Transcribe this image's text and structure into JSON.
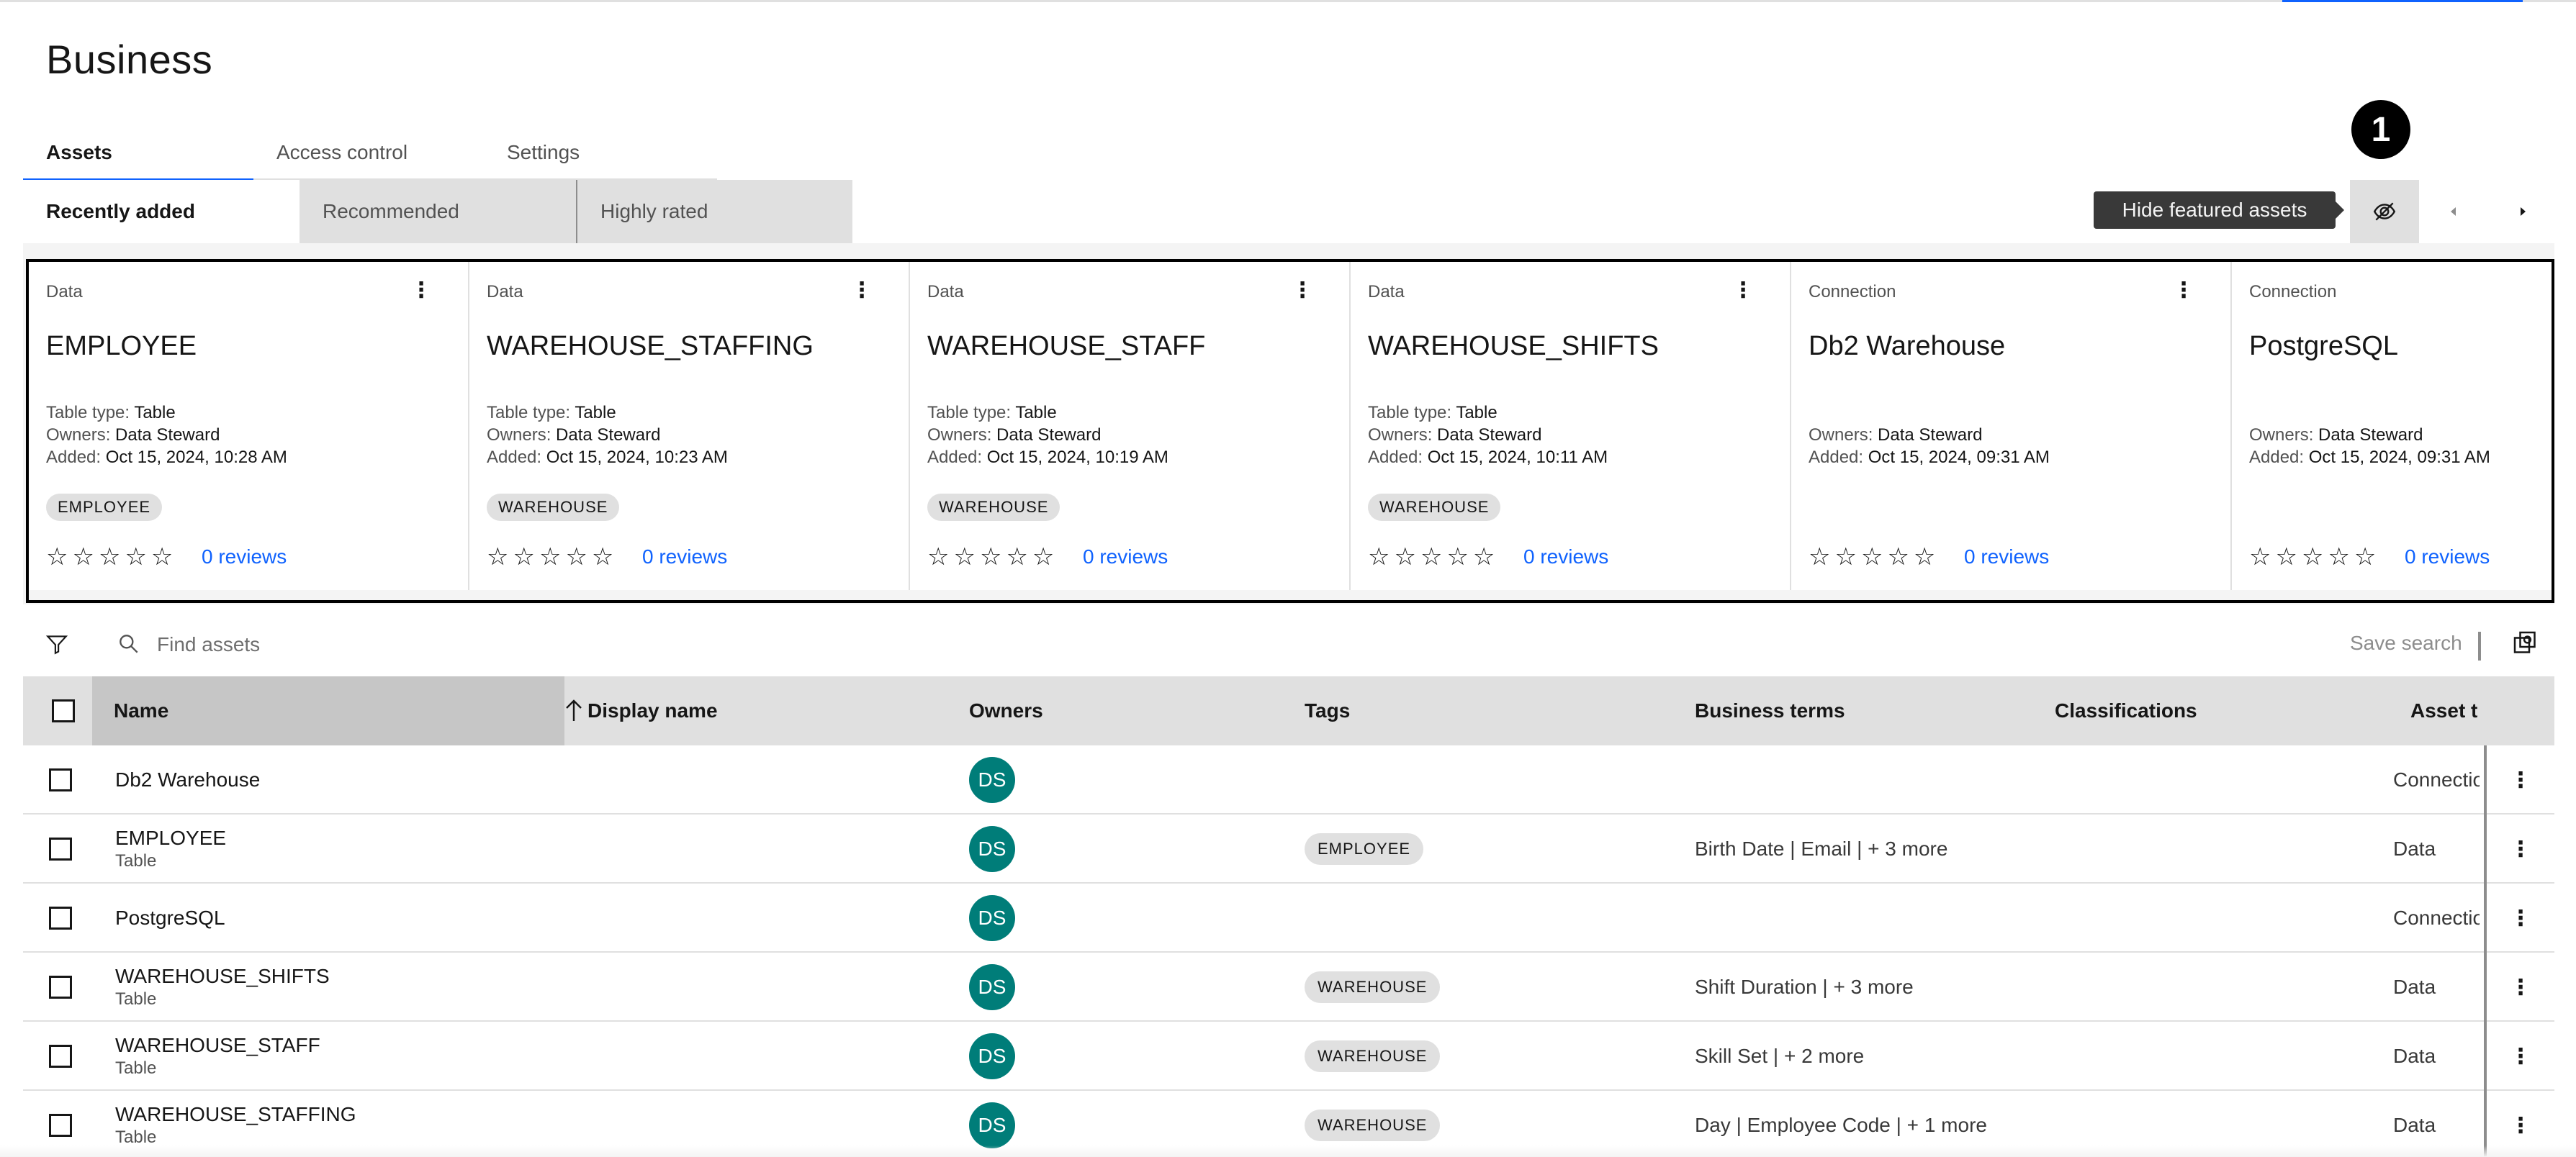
{
  "page": {
    "title": "Business"
  },
  "tabs": [
    "Assets",
    "Access control",
    "Settings"
  ],
  "content_tabs": [
    "Recently added",
    "Recommended",
    "Highly rated"
  ],
  "controls": {
    "tooltip": "Hide featured assets",
    "step_badge": "1"
  },
  "cards": [
    {
      "type": "Data",
      "title": "EMPLOYEE",
      "table_type_label": "Table type:",
      "table_type": "Table",
      "owners_label": "Owners:",
      "owners": "Data Steward",
      "added_label": "Added:",
      "added": "Oct 15, 2024, 10:28 AM",
      "tag": "EMPLOYEE",
      "reviews": "0 reviews"
    },
    {
      "type": "Data",
      "title": "WAREHOUSE_STAFFING",
      "table_type_label": "Table type:",
      "table_type": "Table",
      "owners_label": "Owners:",
      "owners": "Data Steward",
      "added_label": "Added:",
      "added": "Oct 15, 2024, 10:23 AM",
      "tag": "WAREHOUSE",
      "reviews": "0 reviews"
    },
    {
      "type": "Data",
      "title": "WAREHOUSE_STAFF",
      "table_type_label": "Table type:",
      "table_type": "Table",
      "owners_label": "Owners:",
      "owners": "Data Steward",
      "added_label": "Added:",
      "added": "Oct 15, 2024, 10:19 AM",
      "tag": "WAREHOUSE",
      "reviews": "0 reviews"
    },
    {
      "type": "Data",
      "title": "WAREHOUSE_SHIFTS",
      "table_type_label": "Table type:",
      "table_type": "Table",
      "owners_label": "Owners:",
      "owners": "Data Steward",
      "added_label": "Added:",
      "added": "Oct 15, 2024, 10:11 AM",
      "tag": "WAREHOUSE",
      "reviews": "0 reviews"
    },
    {
      "type": "Connection",
      "title": "Db2 Warehouse",
      "owners_label": "Owners:",
      "owners": "Data Steward",
      "added_label": "Added:",
      "added": "Oct 15, 2024, 09:31 AM",
      "reviews": "0 reviews"
    },
    {
      "type": "Connection",
      "title": "PostgreSQL",
      "owners_label": "Owners:",
      "owners": "Data Steward",
      "added_label": "Added:",
      "added": "Oct 15, 2024, 09:31 AM",
      "reviews": "0 reviews"
    }
  ],
  "search": {
    "placeholder": "Find assets",
    "save_label": "Save search"
  },
  "table": {
    "headers": [
      "Name",
      "Display name",
      "Owners",
      "Tags",
      "Business terms",
      "Classifications",
      "Asset t"
    ],
    "rows": [
      {
        "name": "Db2 Warehouse",
        "sub": "",
        "owner": "DS",
        "tag": "",
        "terms": "",
        "asset_type": "Connection"
      },
      {
        "name": "EMPLOYEE",
        "sub": "Table",
        "owner": "DS",
        "tag": "EMPLOYEE",
        "terms": "Birth Date | Email | + 3 more",
        "asset_type": "Data"
      },
      {
        "name": "PostgreSQL",
        "sub": "",
        "owner": "DS",
        "tag": "",
        "terms": "",
        "asset_type": "Connection"
      },
      {
        "name": "WAREHOUSE_SHIFTS",
        "sub": "Table",
        "owner": "DS",
        "tag": "WAREHOUSE",
        "terms": "Shift Duration | + 3 more",
        "asset_type": "Data"
      },
      {
        "name": "WAREHOUSE_STAFF",
        "sub": "Table",
        "owner": "DS",
        "tag": "WAREHOUSE",
        "terms": "Skill Set | + 2 more",
        "asset_type": "Data"
      },
      {
        "name": "WAREHOUSE_STAFFING",
        "sub": "Table",
        "owner": "DS",
        "tag": "WAREHOUSE",
        "terms": "Day | Employee Code | + 1 more",
        "asset_type": "Data"
      }
    ]
  },
  "colors": {
    "accent": "#0f62fe",
    "avatar": "#007d79",
    "tag_bg": "#e0e0e0"
  }
}
